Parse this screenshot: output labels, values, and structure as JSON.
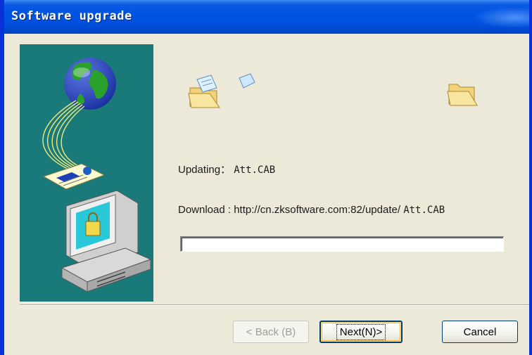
{
  "window": {
    "title": "Software upgrade"
  },
  "status": {
    "updating_label": "Updating：",
    "updating_file": "Att.CAB",
    "download_label": "Download : http://cn.zksoftware.com:82/update/",
    "download_file": "Att.CAB"
  },
  "progress": {
    "fraction": 0
  },
  "buttons": {
    "back": "< Back (B)",
    "next": "Next(N)>",
    "cancel": "Cancel"
  },
  "icons": {
    "source_folder": "open-folder-icon",
    "flying_document": "flying-document-icon",
    "destination_folder": "open-folder-icon",
    "globe": "globe-icon",
    "computer": "computer-lock-icon"
  },
  "colors": {
    "titlebar": "#0054e3",
    "panel": "#1a7a7a",
    "dialog": "#ece9d8"
  }
}
